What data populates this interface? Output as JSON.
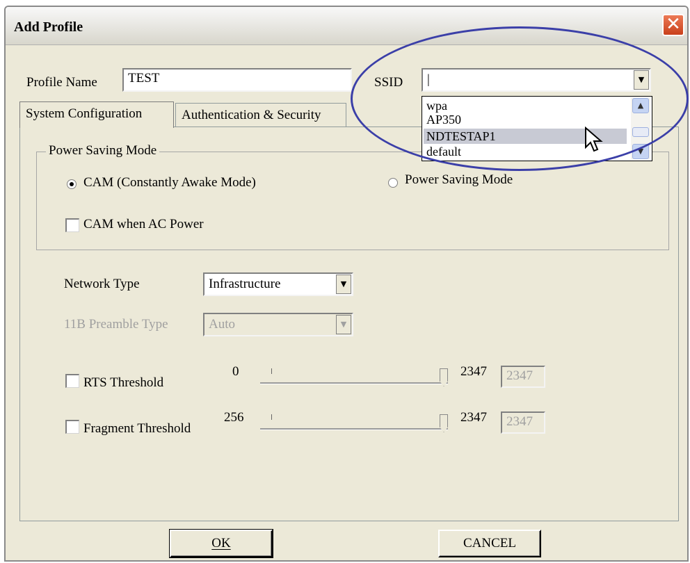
{
  "window": {
    "title": "Add Profile"
  },
  "profile": {
    "label": "Profile Name",
    "value": "TEST"
  },
  "ssid": {
    "label": "SSID",
    "value": "|",
    "options": [
      "wpa",
      "AP350",
      "NDTESTAP1",
      "default"
    ],
    "hovered_option": "NDTESTAP1"
  },
  "tabs": [
    {
      "label": "System Configuration",
      "active": true
    },
    {
      "label": "Authentication & Security",
      "active": false
    }
  ],
  "power_saving": {
    "group_title": "Power Saving Mode",
    "cam_label": "CAM (Constantly Awake Mode)",
    "cam_selected": true,
    "psm_label": "Power Saving Mode",
    "psm_selected": false,
    "cam_ac_label": "CAM when AC Power",
    "cam_ac_checked": false
  },
  "network_type": {
    "label": "Network Type",
    "value": "Infrastructure"
  },
  "preamble": {
    "label": "11B Preamble Type",
    "value": "Auto",
    "disabled": true
  },
  "rts": {
    "label": "RTS Threshold",
    "min": "0",
    "max": "2347",
    "value": "2347",
    "checked": false
  },
  "fragment": {
    "label": "Fragment Threshold",
    "min": "256",
    "max": "2347",
    "value": "2347",
    "checked": false
  },
  "buttons": {
    "ok": "OK",
    "cancel": "CANCEL"
  },
  "icons": {
    "close": "close-icon",
    "dropdown": "chevron-down-icon",
    "scroll_up": "chevron-up-icon",
    "cursor": "mouse-pointer-icon"
  },
  "colors": {
    "highlight": "#3b3fa8",
    "close_button": "#d9532c",
    "dialog_bg": "#ece9d8"
  }
}
